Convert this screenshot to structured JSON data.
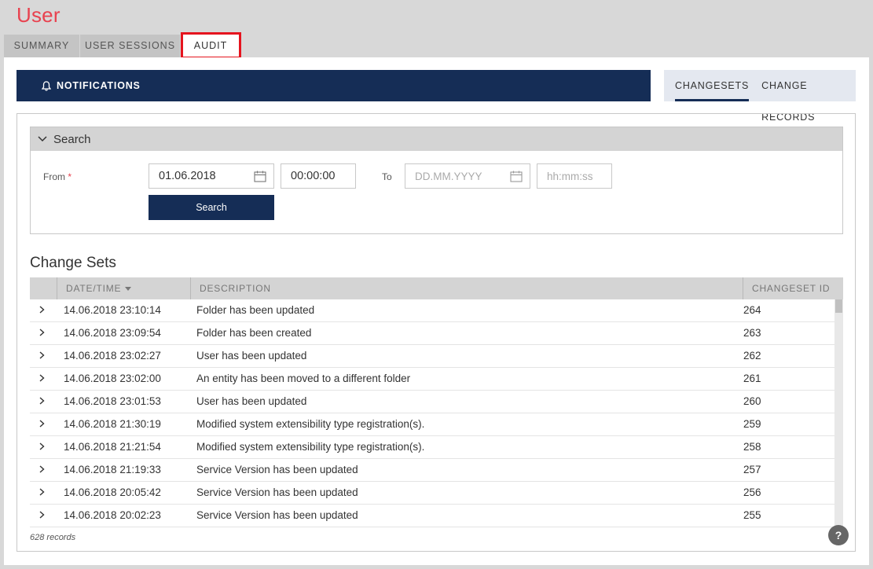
{
  "page": {
    "title": "User"
  },
  "tabs": [
    {
      "label": "SUMMARY"
    },
    {
      "label": "USER SESSIONS"
    },
    {
      "label": "AUDIT"
    }
  ],
  "notifications": {
    "label": "NOTIFICATIONS",
    "icon": "bell-icon"
  },
  "sub_tabs": [
    {
      "label": "CHANGESETS"
    },
    {
      "label": "CHANGE RECORDS"
    }
  ],
  "search": {
    "title": "Search",
    "from_label": "From",
    "required_mark": "*",
    "from_date": "01.06.2018",
    "from_time": "00:00:00",
    "to_label": "To",
    "to_date_placeholder": "DD.MM.YYYY",
    "to_time_placeholder": "hh:mm:ss",
    "button": "Search"
  },
  "change_sets": {
    "title": "Change Sets",
    "columns": [
      "DATE/TIME",
      "DESCRIPTION",
      "CHANGESET ID"
    ],
    "rows": [
      {
        "datetime": "14.06.2018 23:10:14",
        "description": "Folder has been updated",
        "id": "264"
      },
      {
        "datetime": "14.06.2018 23:09:54",
        "description": "Folder has been created",
        "id": "263"
      },
      {
        "datetime": "14.06.2018 23:02:27",
        "description": "User has been updated",
        "id": "262"
      },
      {
        "datetime": "14.06.2018 23:02:00",
        "description": "An entity has been moved to a different folder",
        "id": "261"
      },
      {
        "datetime": "14.06.2018 23:01:53",
        "description": "User has been updated",
        "id": "260"
      },
      {
        "datetime": "14.06.2018 21:30:19",
        "description": "Modified system extensibility type registration(s).",
        "id": "259"
      },
      {
        "datetime": "14.06.2018 21:21:54",
        "description": "Modified system extensibility type registration(s).",
        "id": "258"
      },
      {
        "datetime": "14.06.2018 21:19:33",
        "description": "Service Version has been updated",
        "id": "257"
      },
      {
        "datetime": "14.06.2018 20:05:42",
        "description": "Service Version has been updated",
        "id": "256"
      },
      {
        "datetime": "14.06.2018 20:02:23",
        "description": "Service Version has been updated",
        "id": "255"
      }
    ],
    "records": "628 records"
  },
  "help": {
    "label": "?"
  },
  "colors": {
    "accent_red": "#e8424f",
    "navy": "#152d56",
    "highlight": "#e5141e"
  }
}
